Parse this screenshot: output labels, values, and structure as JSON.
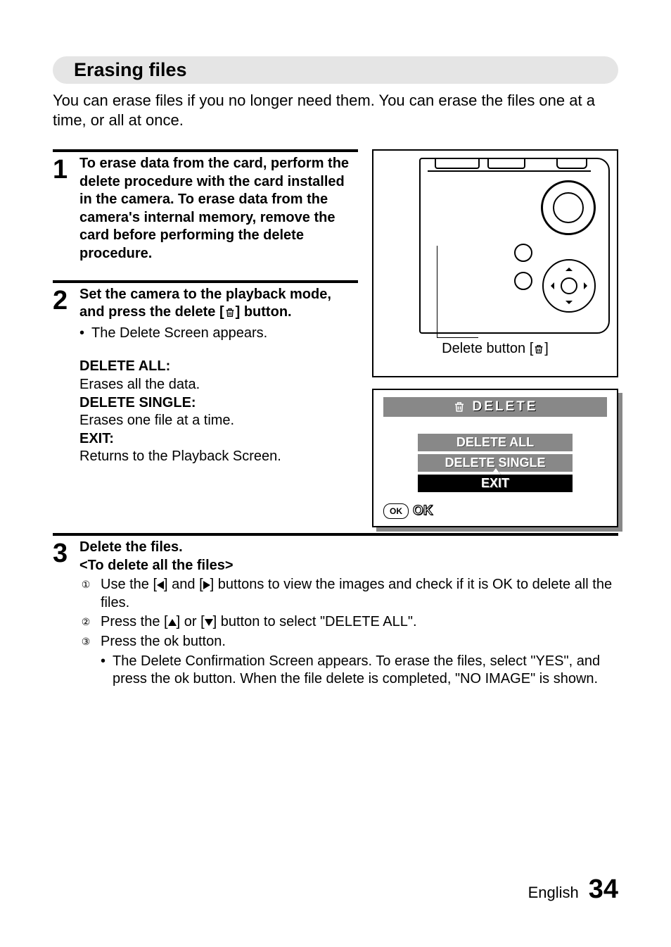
{
  "section_title": "Erasing files",
  "intro": "You can erase files if you no longer need them. You can erase the files one at a time, or all at once.",
  "steps": {
    "s1": {
      "num": "1",
      "heading": "To erase data from the card, perform the delete procedure with the card installed in the camera. To erase data from the camera's internal memory, remove the card before performing the delete procedure."
    },
    "s2": {
      "num": "2",
      "heading_a": "Set the camera to the playback mode, and press the delete [",
      "heading_b": "] button.",
      "bullet": "The Delete Screen appears.",
      "defs": {
        "da_t": "DELETE ALL:",
        "da_d": "Erases all the data.",
        "ds_t": "DELETE SINGLE:",
        "ds_d": "Erases one file at a time.",
        "ex_t": "EXIT:",
        "ex_d": "Returns to the Playback Screen."
      }
    },
    "s3": {
      "num": "3",
      "heading": "Delete the files.",
      "sub": "<To delete all the files>",
      "i1a": "Use the [",
      "i1b": "] and [",
      "i1c": "] buttons to view the images and check if it is OK to delete all the files.",
      "i2a": "Press the [",
      "i2b": "] or [",
      "i2c": "] button to select \"DELETE ALL\".",
      "i3": "Press the ok button.",
      "i3_bullet": "The Delete Confirmation Screen appears. To erase the files, select \"YES\", and press the ok button. When the file delete is completed, \"NO IMAGE\" is shown."
    }
  },
  "diagram": {
    "label_a": "Delete button [",
    "label_b": "]"
  },
  "screen": {
    "title": "DELETE",
    "opt1": "DELETE ALL",
    "opt2": "DELETE SINGLE",
    "opt3": "EXIT",
    "ok_pill": "OK",
    "ok_text": "OK"
  },
  "footer": {
    "lang": "English",
    "page": "34"
  },
  "glyphs": {
    "c1": "①",
    "c2": "②",
    "c3": "③",
    "dot": "•"
  }
}
